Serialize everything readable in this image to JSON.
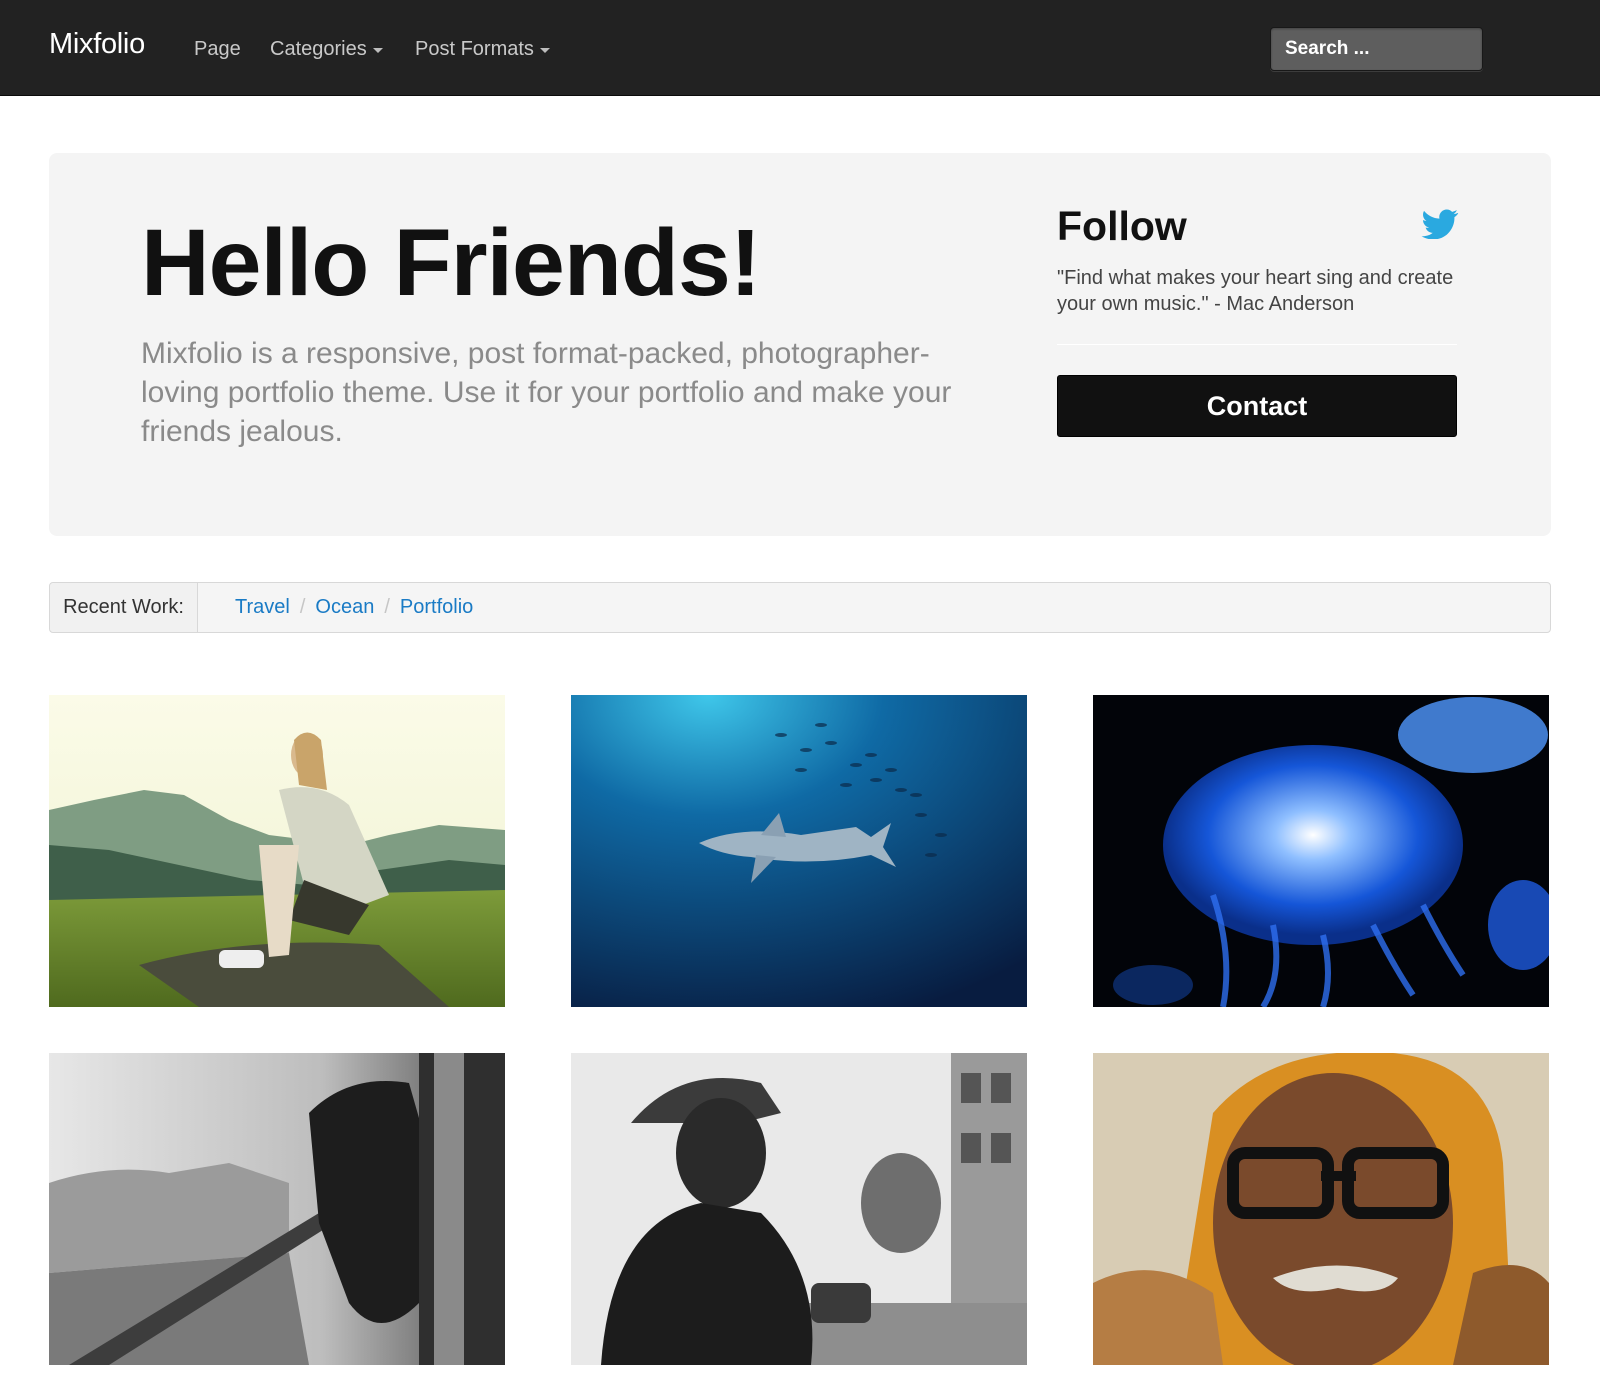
{
  "navbar": {
    "brand": "Mixfolio",
    "items": [
      {
        "label": "Page"
      },
      {
        "label": "Categories"
      },
      {
        "label": "Post Formats"
      }
    ],
    "search_placeholder": "Search ..."
  },
  "hero": {
    "title": "Hello Friends!",
    "text": "Mixfolio is a responsive, post format-packed, photographer-loving portfolio theme. Use it for your portfolio and make your friends jealous.",
    "follow_title": "Follow",
    "follow_icon": "twitter-bird-icon",
    "quote": "\"Find what makes your heart sing and create your own music.\" - Mac Anderson",
    "contact_label": "Contact"
  },
  "recent": {
    "label": "Recent Work:",
    "links": [
      "Travel",
      "Ocean",
      "Portfolio"
    ]
  },
  "gallery": [
    {
      "subject": "woman-sitting-on-hill-photo"
    },
    {
      "subject": "shark-underwater-photo"
    },
    {
      "subject": "blue-jellyfish-photo"
    },
    {
      "subject": "train-window-bw-photo"
    },
    {
      "subject": "man-in-cap-bw-photo"
    },
    {
      "subject": "old-man-turban-photo"
    }
  ],
  "colors": {
    "navbar_bg": "#222222",
    "hero_bg": "#f4f4f4",
    "link": "#1a7bc5",
    "button_bg": "#111111",
    "twitter": "#2aa9e0"
  }
}
